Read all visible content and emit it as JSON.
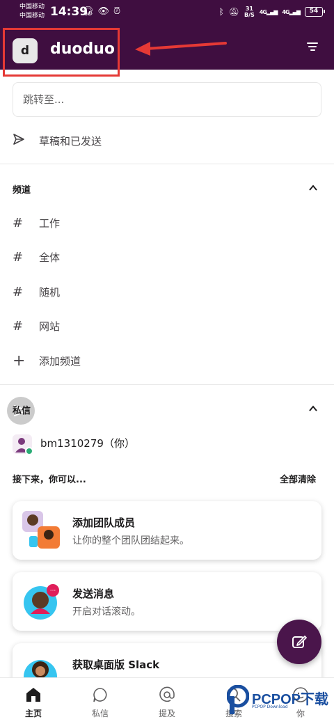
{
  "status_bar": {
    "carrier_1": "中国移动",
    "carrier_2": "中国移动",
    "time": "14:39",
    "net_speed_top": "31",
    "net_speed_bottom": "B/S",
    "sig1": "4G",
    "sig2": "4G",
    "battery": "54",
    "icons": [
      "headphones-icon",
      "eye-icon",
      "alarm-icon",
      "bluetooth-icon",
      "mute-icon",
      "signal-icon",
      "battery-icon"
    ]
  },
  "header": {
    "workspace_initial": "d",
    "workspace_name": "duoduo",
    "annotation_color": "#e53935",
    "bg_color": "#3f0e40"
  },
  "search": {
    "placeholder": "跳转至..."
  },
  "drafts": {
    "label": "草稿和已发送"
  },
  "channels": {
    "title": "频道",
    "items": [
      {
        "prefix": "#",
        "label": "工作"
      },
      {
        "prefix": "#",
        "label": "全体"
      },
      {
        "prefix": "#",
        "label": "随机"
      },
      {
        "prefix": "#",
        "label": "网站"
      }
    ],
    "add_label": "添加频道"
  },
  "dms": {
    "title": "私信",
    "user": "bm1310279（你）"
  },
  "next_steps": {
    "title": "接下来，你可以...",
    "clear_all": "全部清除",
    "cards": [
      {
        "title": "添加团队成员",
        "subtitle": "让你的整个团队团结起来。"
      },
      {
        "title": "发送消息",
        "subtitle": "开启对话滚动。"
      },
      {
        "title": "获取桌面版 Slack",
        "subtitle": ""
      }
    ]
  },
  "bottom_nav": {
    "tabs": [
      {
        "label": "主页",
        "icon": "home-icon"
      },
      {
        "label": "私信",
        "icon": "dm-icon"
      },
      {
        "label": "提及",
        "icon": "at-icon"
      },
      {
        "label": "搜索",
        "icon": "search-icon"
      },
      {
        "label": "你",
        "icon": "profile-icon"
      }
    ]
  },
  "watermark": {
    "text": "PCPOP下载",
    "sub": "PCPOP Download"
  }
}
